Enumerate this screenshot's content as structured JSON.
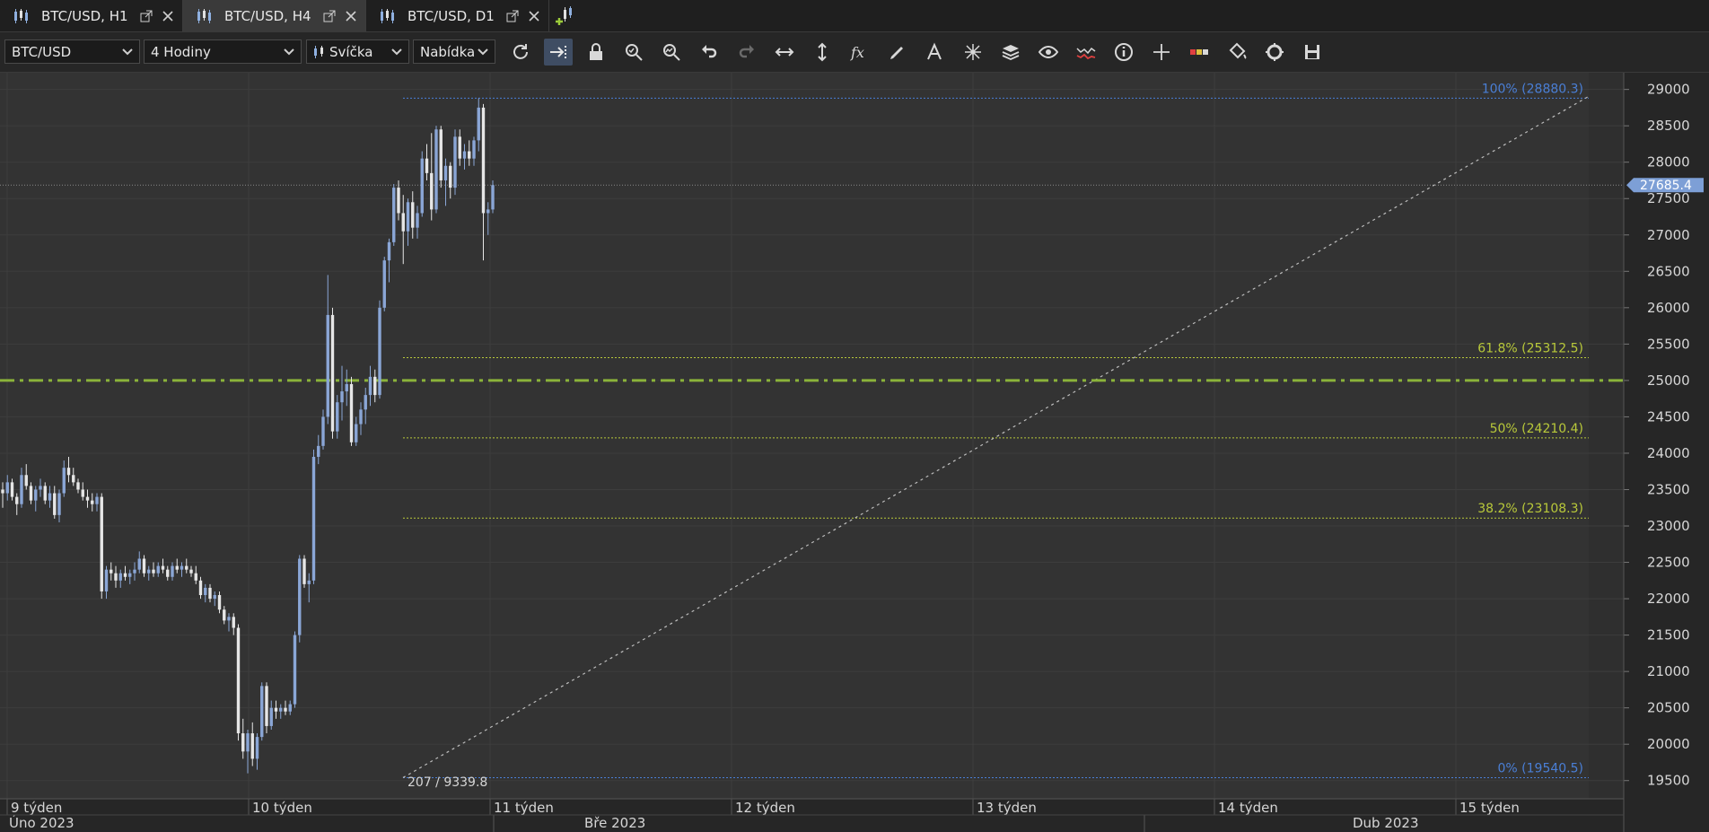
{
  "tabs": [
    {
      "label": "BTC/USD, H1",
      "active": false
    },
    {
      "label": "BTC/USD, H4",
      "active": true
    },
    {
      "label": "BTC/USD, D1",
      "active": false
    }
  ],
  "toolbar": {
    "symbol": "BTC/USD",
    "timeframe": "4 Hodiny",
    "chart_style": "Svíčka",
    "price_side": "Nabídka",
    "icons": [
      "refresh-icon",
      "auto-scroll-icon",
      "lock-icon",
      "zoom-in-icon",
      "zoom-out-icon",
      "undo-icon",
      "redo-icon",
      "horizontal-fit-icon",
      "vertical-fit-icon",
      "indicator-fx-icon",
      "pencil-icon",
      "text-tool-icon",
      "drawing-tools-icon",
      "layers-icon",
      "eye-icon",
      "signals-icon",
      "info-icon",
      "crosshair-icon",
      "color-bars-icon",
      "paint-bucket-icon",
      "settings-reset-icon",
      "save-icon"
    ]
  },
  "chart_data": {
    "type": "candlestick",
    "symbol": "BTC/USD",
    "timeframe": "H4",
    "ylim": [
      19250,
      29230
    ],
    "y_ticks": [
      29000,
      28500,
      28000,
      27500,
      27000,
      26500,
      26000,
      25500,
      25000,
      24500,
      24000,
      23500,
      23000,
      22500,
      22000,
      21500,
      21000,
      20500,
      20000,
      19500
    ],
    "last_price": "27685.4",
    "crosshair_readout": "207 / 9339.8",
    "horizontal_line": {
      "value": 25000,
      "style": "dash-dot",
      "color": "#8ab33a"
    },
    "fibonacci": {
      "levels": [
        {
          "label": "100% (28880.3)",
          "value": 28880.3,
          "color": "#4a7fd6"
        },
        {
          "label": "61.8% (25312.5)",
          "value": 25312.5,
          "color": "#b9c93a"
        },
        {
          "label": "50% (24210.4)",
          "value": 24210.4,
          "color": "#b9c93a"
        },
        {
          "label": "38.2% (23108.3)",
          "value": 23108.3,
          "color": "#b9c93a"
        },
        {
          "label": "0% (19540.5)",
          "value": 19540.5,
          "color": "#4a7fd6"
        }
      ],
      "trend_line": {
        "from_price": 19540.5,
        "to_price": 28880.3
      }
    },
    "x_weeks": [
      "9 týden",
      "10 týden",
      "11 týden",
      "12 týden",
      "13 týden",
      "14 týden",
      "15 týden"
    ],
    "x_months": [
      "Úno 2023",
      "Bře 2023",
      "Dub 2023"
    ],
    "candles": [
      [
        23500,
        23600,
        23250,
        23450
      ],
      [
        23450,
        23700,
        23350,
        23600
      ],
      [
        23600,
        23650,
        23350,
        23400
      ],
      [
        23400,
        23450,
        23150,
        23300
      ],
      [
        23300,
        23800,
        23250,
        23700
      ],
      [
        23700,
        23850,
        23500,
        23550
      ],
      [
        23550,
        23600,
        23300,
        23350
      ],
      [
        23350,
        23550,
        23200,
        23500
      ],
      [
        23500,
        23650,
        23400,
        23550
      ],
      [
        23550,
        23600,
        23300,
        23350
      ],
      [
        23350,
        23550,
        23250,
        23450
      ],
      [
        23450,
        23550,
        23100,
        23150
      ],
      [
        23150,
        23500,
        23050,
        23450
      ],
      [
        23450,
        23900,
        23400,
        23800
      ],
      [
        23800,
        23950,
        23600,
        23700
      ],
      [
        23700,
        23800,
        23550,
        23600
      ],
      [
        23600,
        23650,
        23450,
        23500
      ],
      [
        23500,
        23600,
        23350,
        23400
      ],
      [
        23400,
        23500,
        23250,
        23350
      ],
      [
        23350,
        23450,
        23200,
        23300
      ],
      [
        23300,
        23450,
        23200,
        23400
      ],
      [
        23400,
        23450,
        22000,
        22100
      ],
      [
        22100,
        22450,
        22000,
        22400
      ],
      [
        22400,
        22500,
        22250,
        22350
      ],
      [
        22350,
        22450,
        22150,
        22250
      ],
      [
        22250,
        22400,
        22150,
        22350
      ],
      [
        22350,
        22450,
        22250,
        22300
      ],
      [
        22300,
        22400,
        22200,
        22350
      ],
      [
        22350,
        22500,
        22250,
        22400
      ],
      [
        22400,
        22650,
        22350,
        22550
      ],
      [
        22550,
        22600,
        22300,
        22350
      ],
      [
        22350,
        22450,
        22250,
        22400
      ],
      [
        22400,
        22500,
        22300,
        22350
      ],
      [
        22350,
        22500,
        22300,
        22450
      ],
      [
        22450,
        22550,
        22350,
        22400
      ],
      [
        22400,
        22450,
        22250,
        22300
      ],
      [
        22300,
        22500,
        22250,
        22450
      ],
      [
        22450,
        22550,
        22350,
        22400
      ],
      [
        22400,
        22500,
        22300,
        22450
      ],
      [
        22450,
        22550,
        22350,
        22400
      ],
      [
        22400,
        22450,
        22300,
        22350
      ],
      [
        22350,
        22450,
        22200,
        22250
      ],
      [
        22250,
        22300,
        22000,
        22050
      ],
      [
        22050,
        22200,
        21950,
        22150
      ],
      [
        22150,
        22200,
        21950,
        22000
      ],
      [
        22000,
        22100,
        21900,
        22050
      ],
      [
        22050,
        22100,
        21800,
        21850
      ],
      [
        21850,
        21900,
        21650,
        21700
      ],
      [
        21700,
        21800,
        21550,
        21750
      ],
      [
        21750,
        21800,
        21500,
        21600
      ],
      [
        21600,
        21650,
        20050,
        20150
      ],
      [
        20150,
        20350,
        19800,
        19900
      ],
      [
        19900,
        20200,
        19600,
        20150
      ],
      [
        20150,
        20300,
        19700,
        19800
      ],
      [
        19800,
        20150,
        19650,
        20100
      ],
      [
        20100,
        20850,
        20050,
        20800
      ],
      [
        20800,
        20850,
        20150,
        20250
      ],
      [
        20250,
        20600,
        20200,
        20500
      ],
      [
        20500,
        20600,
        20350,
        20450
      ],
      [
        20450,
        20550,
        20350,
        20500
      ],
      [
        20500,
        20600,
        20400,
        20450
      ],
      [
        20450,
        20600,
        20400,
        20550
      ],
      [
        20550,
        21550,
        20500,
        21500
      ],
      [
        21500,
        22600,
        21400,
        22550
      ],
      [
        22550,
        22600,
        22150,
        22200
      ],
      [
        22200,
        22350,
        21950,
        22250
      ],
      [
        22250,
        24050,
        22200,
        23950
      ],
      [
        23950,
        24250,
        23850,
        24100
      ],
      [
        24100,
        24600,
        24050,
        24500
      ],
      [
        24500,
        26450,
        24400,
        25900
      ],
      [
        25900,
        26000,
        24200,
        24300
      ],
      [
        24300,
        24800,
        24200,
        24700
      ],
      [
        24700,
        25200,
        24450,
        24850
      ],
      [
        24850,
        25150,
        24650,
        24950
      ],
      [
        24950,
        25050,
        24100,
        24150
      ],
      [
        24150,
        24500,
        24100,
        24400
      ],
      [
        24400,
        24700,
        24250,
        24600
      ],
      [
        24600,
        24900,
        24400,
        24800
      ],
      [
        24800,
        25200,
        24650,
        25050
      ],
      [
        25050,
        25150,
        24700,
        24800
      ],
      [
        24800,
        26100,
        24750,
        26000
      ],
      [
        26000,
        26700,
        25950,
        26650
      ],
      [
        26650,
        26950,
        26350,
        26900
      ],
      [
        26900,
        27700,
        26850,
        27650
      ],
      [
        27650,
        27750,
        27200,
        27300
      ],
      [
        27300,
        27550,
        26600,
        27050
      ],
      [
        27050,
        27500,
        26850,
        27450
      ],
      [
        27450,
        27600,
        26950,
        27100
      ],
      [
        27100,
        27400,
        26950,
        27300
      ],
      [
        27300,
        28150,
        27250,
        28050
      ],
      [
        28050,
        28250,
        27750,
        27850
      ],
      [
        27850,
        28400,
        27200,
        27350
      ],
      [
        27350,
        28500,
        27300,
        28450
      ],
      [
        28450,
        28500,
        27650,
        27750
      ],
      [
        27750,
        28050,
        27400,
        27950
      ],
      [
        27950,
        28000,
        27500,
        27650
      ],
      [
        27650,
        28450,
        27550,
        28350
      ],
      [
        28350,
        28450,
        27950,
        28050
      ],
      [
        28050,
        28250,
        27900,
        28150
      ],
      [
        28150,
        28300,
        27950,
        28050
      ],
      [
        28050,
        28350,
        27950,
        28300
      ],
      [
        28300,
        28880,
        28150,
        28750
      ],
      [
        28750,
        28800,
        26650,
        27300
      ],
      [
        27300,
        27450,
        27000,
        27350
      ],
      [
        27350,
        27750,
        27300,
        27685
      ]
    ]
  }
}
